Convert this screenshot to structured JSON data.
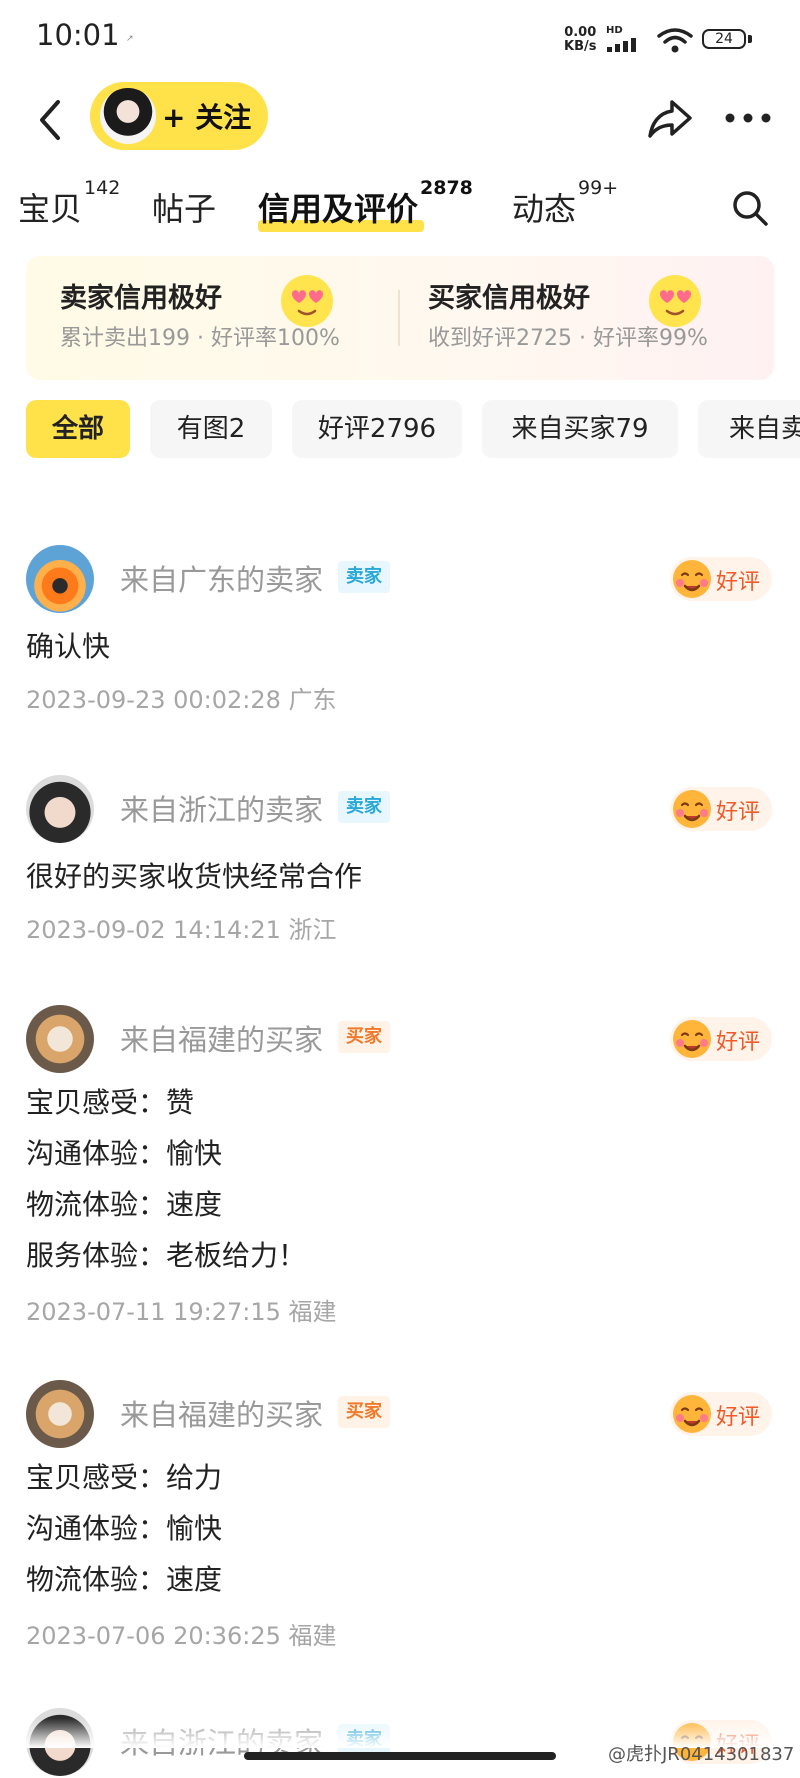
{
  "status_bar": {
    "time": "10:01",
    "notif": "↗",
    "net_speed_value": "0.00",
    "net_speed_unit": "KB/s",
    "hd": "HD",
    "battery": "24"
  },
  "nav": {
    "follow_label": "+ 关注"
  },
  "tabs": [
    {
      "label": "宝贝",
      "count": "142"
    },
    {
      "label": "帖子",
      "count": ""
    },
    {
      "label": "信用及评价",
      "count": "2878"
    },
    {
      "label": "动态",
      "count": "99+"
    }
  ],
  "credit": {
    "seller_title": "卖家信用极好",
    "seller_sub": "累计卖出199 · 好评率100%",
    "buyer_title": "买家信用极好",
    "buyer_sub": "收到好评2725 · 好评率99%"
  },
  "filters": [
    {
      "label": "全部",
      "active": true
    },
    {
      "label": "有图2",
      "active": false
    },
    {
      "label": "好评2796",
      "active": false
    },
    {
      "label": "来自买家79",
      "active": false
    },
    {
      "label": "来自卖",
      "active": false
    }
  ],
  "reviews": [
    {
      "reviewer": "来自广东的卖家",
      "role": "卖家",
      "rating": "好评",
      "lines": [
        "确认快"
      ],
      "meta": "2023-09-23 00:02:28 广东"
    },
    {
      "reviewer": "来自浙江的卖家",
      "role": "卖家",
      "rating": "好评",
      "lines": [
        "很好的买家收货快经常合作"
      ],
      "meta": "2023-09-02 14:14:21 浙江"
    },
    {
      "reviewer": "来自福建的买家",
      "role": "买家",
      "rating": "好评",
      "lines": [
        "宝贝感受：赞",
        "沟通体验：愉快",
        "物流体验：速度",
        "服务体验：老板给力！"
      ],
      "meta": "2023-07-11 19:27:15 福建"
    },
    {
      "reviewer": "来自福建的买家",
      "role": "买家",
      "rating": "好评",
      "lines": [
        "宝贝感受：给力",
        "沟通体验：愉快",
        "物流体验：速度"
      ],
      "meta": "2023-07-06 20:36:25 福建"
    },
    {
      "reviewer": "来自浙江的卖家",
      "role": "卖家",
      "rating": "好评",
      "lines": [],
      "meta": ""
    }
  ],
  "watermark": "@虎扑JR0414301837",
  "colors": {
    "accent_yellow": "#ffe14a",
    "seller_badge": "#2aa8d8",
    "buyer_badge": "#f07a2c",
    "rating_text": "#f05a28"
  }
}
